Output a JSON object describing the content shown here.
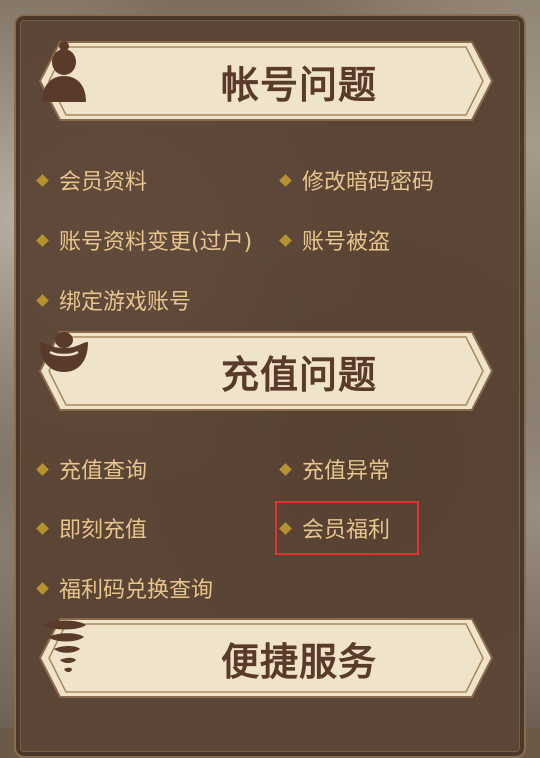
{
  "sections": [
    {
      "title": "帐号问题",
      "icon": "person-silhouette-icon",
      "items": [
        "会员资料",
        "修改暗码密码",
        "账号资料变更(过户)",
        "账号被盗",
        "绑定游戏账号"
      ]
    },
    {
      "title": "充值问题",
      "icon": "gold-ingot-icon",
      "items": [
        "充值查询",
        "充值异常",
        "即刻充值",
        "会员福利",
        "福利码兑换查询"
      ]
    },
    {
      "title": "便捷服务",
      "icon": "tornado-icon",
      "items": []
    }
  ],
  "highlighted_item": "会员福利",
  "colors": {
    "panel": "#5b4536",
    "banner": "#efe3c9",
    "banner_text": "#5a3a2a",
    "item_text": "#e8c58a",
    "bullet": "#b5922f",
    "highlight": "#e0332e"
  }
}
